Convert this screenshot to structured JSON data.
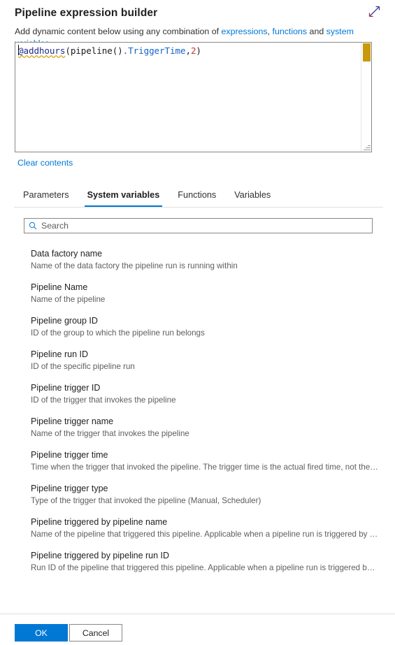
{
  "header": {
    "title": "Pipeline expression builder",
    "expand_icon": "expand-diagonal-icon"
  },
  "description": {
    "prefix": "Add dynamic content below using any combination of ",
    "link_expressions": "expressions",
    "separator_comma": ", ",
    "link_functions": "functions",
    "conjunction": " and ",
    "link_system_variables": "system variables",
    "suffix": "."
  },
  "editor": {
    "expression_full": "@addhours(pipeline().TriggerTime,2)",
    "tokens": {
      "fn": "@addhours",
      "open_paren": "(",
      "pipeline": "pipeline",
      "empty_parens": "()",
      "property": ".TriggerTime",
      "comma": ",",
      "number": "2",
      "close_paren": ")"
    },
    "scrollbar_thumb_color": "#c99a08"
  },
  "clear_contents_label": "Clear contents",
  "tabs": [
    {
      "label": "Parameters",
      "active": false
    },
    {
      "label": "System variables",
      "active": true
    },
    {
      "label": "Functions",
      "active": false
    },
    {
      "label": "Variables",
      "active": false
    }
  ],
  "search": {
    "placeholder": "Search",
    "value": "",
    "icon": "search-icon"
  },
  "variables": [
    {
      "name": "Data factory name",
      "desc": "Name of the data factory the pipeline run is running within"
    },
    {
      "name": "Pipeline Name",
      "desc": "Name of the pipeline"
    },
    {
      "name": "Pipeline group ID",
      "desc": "ID of the group to which the pipeline run belongs"
    },
    {
      "name": "Pipeline run ID",
      "desc": "ID of the specific pipeline run"
    },
    {
      "name": "Pipeline trigger ID",
      "desc": "ID of the trigger that invokes the pipeline"
    },
    {
      "name": "Pipeline trigger name",
      "desc": "Name of the trigger that invokes the pipeline"
    },
    {
      "name": "Pipeline trigger time",
      "desc": "Time when the trigger that invoked the pipeline. The trigger time is the actual fired time, not the sched…"
    },
    {
      "name": "Pipeline trigger type",
      "desc": "Type of the trigger that invoked the pipeline (Manual, Scheduler)"
    },
    {
      "name": "Pipeline triggered by pipeline name",
      "desc": "Name of the pipeline that triggered this pipeline. Applicable when a pipeline run is triggered by an Exe…"
    },
    {
      "name": "Pipeline triggered by pipeline run ID",
      "desc": "Run ID of the pipeline that triggered this pipeline. Applicable when a pipeline run is triggered by an Ex…"
    }
  ],
  "footer": {
    "ok_label": "OK",
    "cancel_label": "Cancel"
  },
  "colors": {
    "accent": "#0078d4",
    "link": "#0078d4",
    "tab_underline": "#0078d4",
    "scrollbar_thumb": "#c99a08",
    "function_token": "#1f2a8c",
    "property_token": "#1464c8",
    "number_token": "#c0392b"
  }
}
